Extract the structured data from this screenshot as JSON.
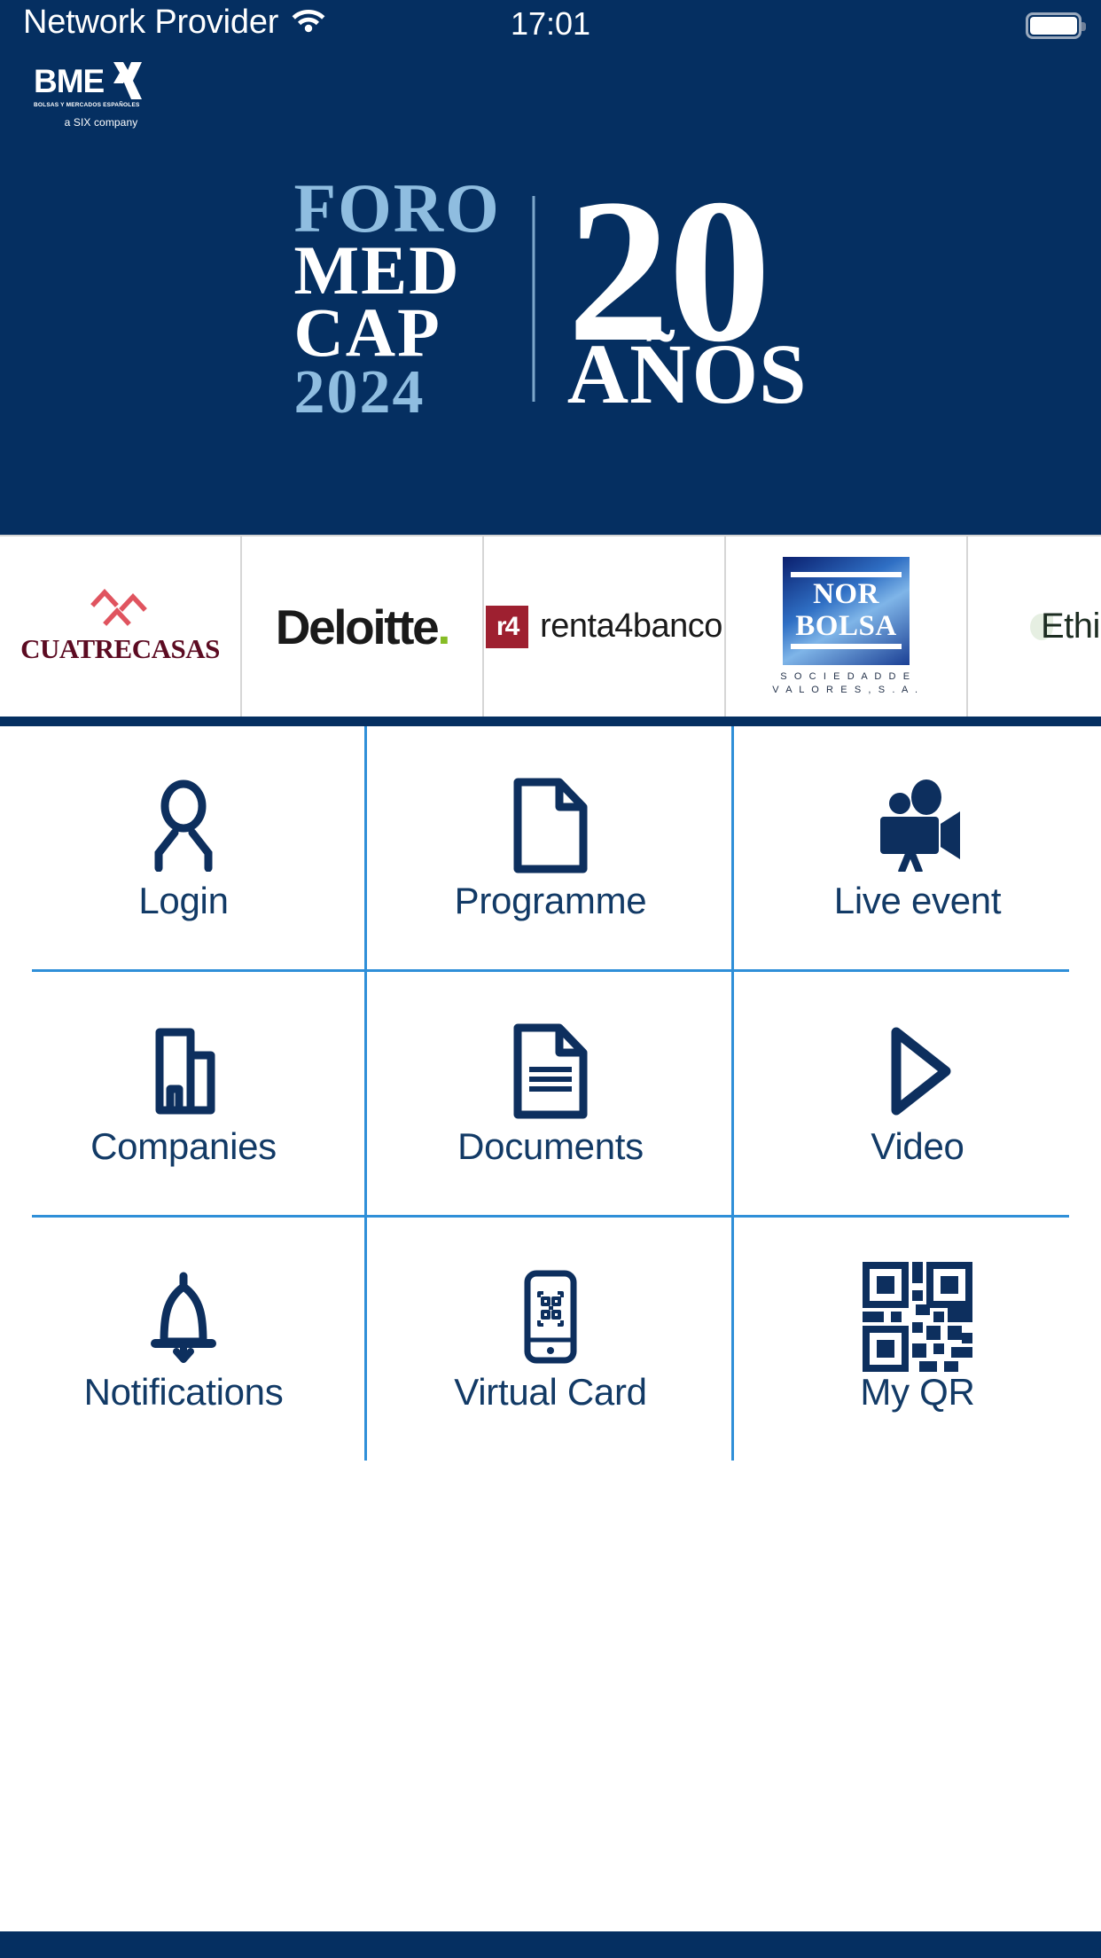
{
  "status_bar": {
    "carrier": "Network Provider",
    "wifi_icon": "wifi-icon",
    "time": "17:01",
    "battery_icon": "battery-full-icon"
  },
  "hero": {
    "background_color": "#052f61",
    "brand_logo": {
      "name": "BME",
      "tagline": "BOLSAS Y MERCADOS ESPAÑOLES",
      "parent": "a SIX company",
      "mark_icon": "bme-x-icon"
    },
    "event_logo": {
      "line1": "FORO",
      "line2": "MED",
      "line3": "CAP",
      "line4": "2024",
      "anniversary_number": "20",
      "anniversary_word": "AÑOS",
      "accent_color": "#8fbde0"
    }
  },
  "sponsors": {
    "items": [
      {
        "id": "cuatrecasas",
        "name": "CUATRECASAS",
        "mark_icon": "cuatrecasas-chevrons-icon",
        "text_color": "#5c0b22",
        "mark_color": "#e0545f"
      },
      {
        "id": "deloitte",
        "name": "Deloitte",
        "dot": ".",
        "mark_icon": "deloitte-dot-icon",
        "text_color": "#1a1a1a",
        "dot_color": "#86bc25"
      },
      {
        "id": "renta4banco",
        "badge": "r4",
        "name": "renta4banco",
        "mark_icon": "renta4-badge-icon",
        "badge_color": "#9e2030"
      },
      {
        "id": "norbolsa",
        "line1": "NOR",
        "line2": "BOLSA",
        "sub1": "S O C I E D A D   D E",
        "sub2": "V A L O R E S ,   S . A .",
        "mark_icon": "norbolsa-logo-icon"
      },
      {
        "id": "ethifin",
        "name": "EthiFin",
        "mark_icon": "ethifin-leaf-icon"
      }
    ]
  },
  "menu": {
    "accent_color": "#2f8fd8",
    "label_color": "#123a66",
    "tiles": [
      {
        "id": "login",
        "label": "Login",
        "icon": "user-icon"
      },
      {
        "id": "programme",
        "label": "Programme",
        "icon": "document-blank-icon"
      },
      {
        "id": "live-event",
        "label": "Live event",
        "icon": "movie-camera-icon"
      },
      {
        "id": "companies",
        "label": "Companies",
        "icon": "buildings-icon"
      },
      {
        "id": "documents",
        "label": "Documents",
        "icon": "document-lines-icon"
      },
      {
        "id": "video",
        "label": "Video",
        "icon": "play-triangle-icon"
      },
      {
        "id": "notifications",
        "label": "Notifications",
        "icon": "bell-icon"
      },
      {
        "id": "virtual-card",
        "label": "Virtual Card",
        "icon": "phone-qr-icon"
      },
      {
        "id": "my-qr",
        "label": "My QR",
        "icon": "qr-code-icon"
      }
    ]
  }
}
